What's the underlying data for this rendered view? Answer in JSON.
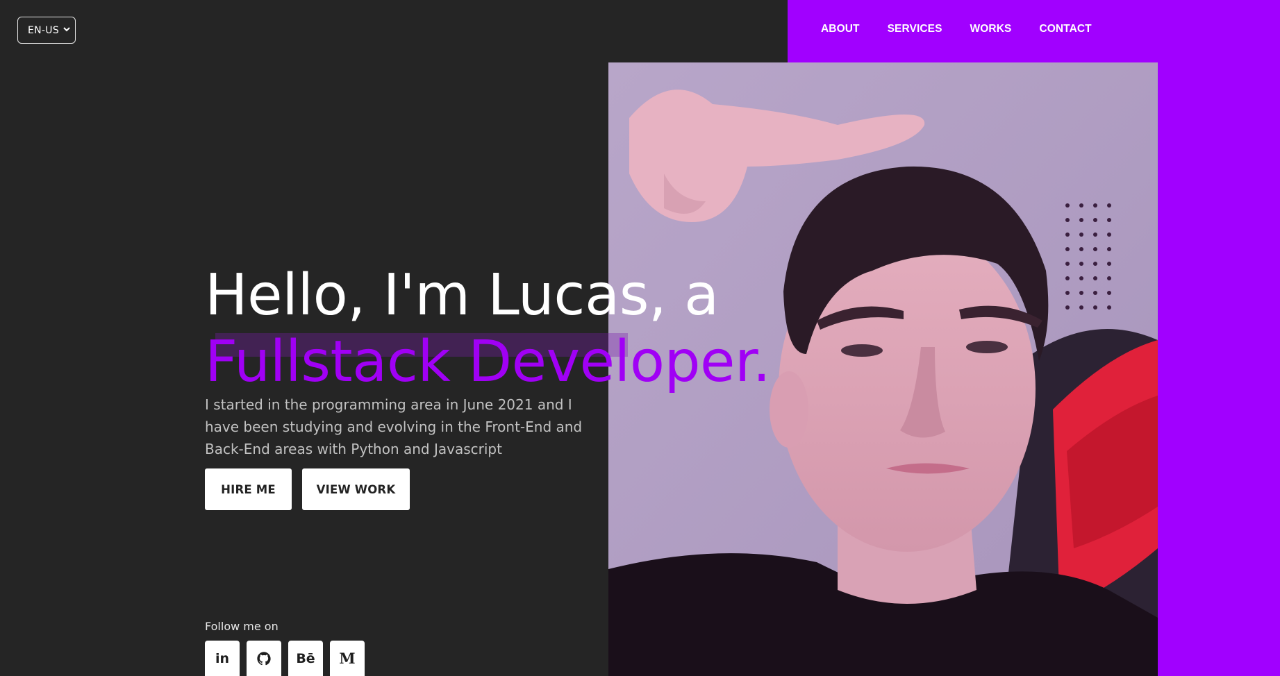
{
  "header": {
    "language_select": {
      "value": "EN-US"
    },
    "nav": [
      {
        "label": "ABOUT"
      },
      {
        "label": "SERVICES"
      },
      {
        "label": "WORKS"
      },
      {
        "label": "CONTACT"
      }
    ]
  },
  "hero": {
    "headline_line1": "Hello, I'm Lucas, a",
    "headline_line2": "Fullstack Developer.",
    "description": "I started in the programming area in June 2021 and I have been studying and evolving in the Front-End and Back-End areas with Python and Javascript",
    "buttons": {
      "hire": "HIRE ME",
      "work": "VIEW WORK"
    }
  },
  "follow": {
    "label": "Follow me on",
    "links": [
      {
        "icon": "linkedin-icon",
        "text": "in"
      },
      {
        "icon": "github-icon"
      },
      {
        "icon": "behance-icon",
        "text": "Bē"
      },
      {
        "icon": "medium-icon",
        "text": "M"
      }
    ]
  },
  "colors": {
    "background": "#252525",
    "accent": "#a100ff",
    "text_primary": "#ffffff",
    "text_secondary": "#c2c2c2"
  }
}
